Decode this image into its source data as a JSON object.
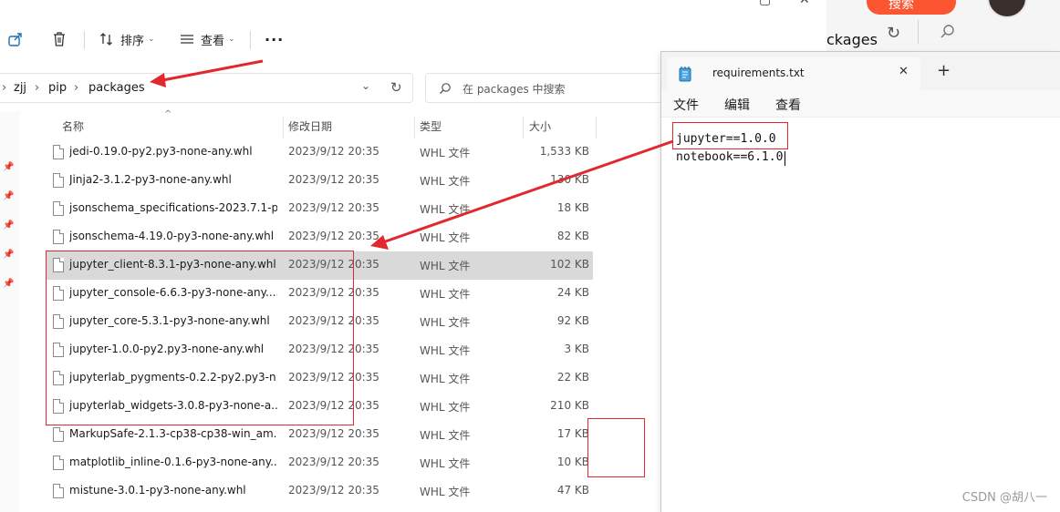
{
  "background_window": {
    "search_button": "搜索",
    "breadcrumb_fragment": "ckages"
  },
  "toolbar": {
    "sort_label": "排序",
    "view_label": "查看",
    "more_label": "···"
  },
  "address_bar": {
    "crumbs": [
      "zjj",
      "pip",
      "packages"
    ],
    "search_placeholder": "在 packages 中搜索"
  },
  "columns": {
    "name": "名称",
    "modified": "修改日期",
    "type": "类型",
    "size": "大小"
  },
  "files": [
    {
      "name": "jedi-0.19.0-py2.py3-none-any.whl",
      "modified": "2023/9/12 20:35",
      "type": "WHL 文件",
      "size": "1,533 KB"
    },
    {
      "name": "Jinja2-3.1.2-py3-none-any.whl",
      "modified": "2023/9/12 20:35",
      "type": "WHL 文件",
      "size": "130 KB"
    },
    {
      "name": "jsonschema_specifications-2023.7.1-p...",
      "modified": "2023/9/12 20:35",
      "type": "WHL 文件",
      "size": "18 KB"
    },
    {
      "name": "jsonschema-4.19.0-py3-none-any.whl",
      "modified": "2023/9/12 20:35",
      "type": "WHL 文件",
      "size": "82 KB"
    },
    {
      "name": "jupyter_client-8.3.1-py3-none-any.whl",
      "modified": "2023/9/12 20:35",
      "type": "WHL 文件",
      "size": "102 KB"
    },
    {
      "name": "jupyter_console-6.6.3-py3-none-any....",
      "modified": "2023/9/12 20:35",
      "type": "WHL 文件",
      "size": "24 KB"
    },
    {
      "name": "jupyter_core-5.3.1-py3-none-any.whl",
      "modified": "2023/9/12 20:35",
      "type": "WHL 文件",
      "size": "92 KB"
    },
    {
      "name": "jupyter-1.0.0-py2.py3-none-any.whl",
      "modified": "2023/9/12 20:35",
      "type": "WHL 文件",
      "size": "3 KB"
    },
    {
      "name": "jupyterlab_pygments-0.2.2-py2.py3-n...",
      "modified": "2023/9/12 20:35",
      "type": "WHL 文件",
      "size": "22 KB"
    },
    {
      "name": "jupyterlab_widgets-3.0.8-py3-none-a...",
      "modified": "2023/9/12 20:35",
      "type": "WHL 文件",
      "size": "210 KB"
    },
    {
      "name": "MarkupSafe-2.1.3-cp38-cp38-win_am...",
      "modified": "2023/9/12 20:35",
      "type": "WHL 文件",
      "size": "17 KB"
    },
    {
      "name": "matplotlib_inline-0.1.6-py3-none-any....",
      "modified": "2023/9/12 20:35",
      "type": "WHL 文件",
      "size": "10 KB"
    },
    {
      "name": "mistune-3.0.1-py3-none-any.whl",
      "modified": "2023/9/12 20:35",
      "type": "WHL 文件",
      "size": "47 KB"
    }
  ],
  "notepad": {
    "tab_title": "requirements.txt",
    "close_glyph": "✕",
    "new_tab_glyph": "+",
    "menu": [
      "文件",
      "编辑",
      "查看"
    ],
    "lines": [
      "jupyter==1.0.0",
      "notebook==6.1.0"
    ]
  },
  "watermark": "CSDN @胡八一",
  "colors": {
    "annotation_red": "#e0282e",
    "selected_row": "#d9d9d9",
    "search_button_bg": "#fc5531"
  }
}
